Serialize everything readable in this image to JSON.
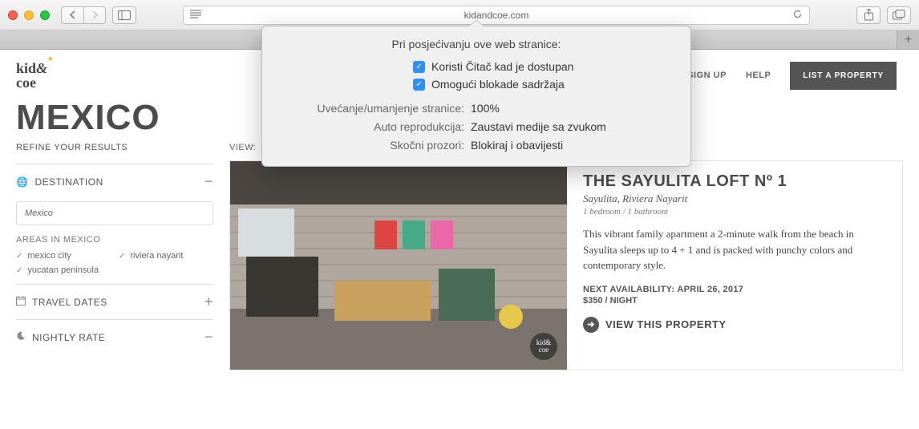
{
  "browser": {
    "url": "kidandcoe.com"
  },
  "site": {
    "logo_line1": "kid",
    "logo_amp": "&",
    "logo_line2": "coe",
    "nav": {
      "signup": "SIGN UP",
      "help": "HELP",
      "cta": "LIST A PROPERTY"
    },
    "page_title": "MEXICO",
    "refine_label": "REFINE YOUR RESULTS",
    "view_label": "VIEW:",
    "filters": {
      "destination": {
        "label": "DESTINATION",
        "input_value": "Mexico",
        "areas_label": "AREAS IN MEXICO",
        "areas": [
          "mexico city",
          "riviera nayarit",
          "yucatan peninsula"
        ]
      },
      "travel_dates": {
        "label": "TRAVEL DATES"
      },
      "nightly_rate": {
        "label": "NIGHTLY RATE"
      }
    },
    "listing": {
      "title": "THE SAYULITA LOFT Nº 1",
      "location": "Sayulita, Riviera Nayarit",
      "meta": "1 bedroom / 1 bathroom",
      "description": "This vibrant family apartment a 2-minute walk from the beach in Sayulita sleeps up to 4 + 1 and is packed with punchy colors and contemporary style.",
      "availability": "NEXT AVAILABILITY: APRIL 26, 2017",
      "price": "$350 / NIGHT",
      "view_label": "VIEW THIS PROPERTY",
      "badge": "kid& coe"
    }
  },
  "popover": {
    "title": "Pri posjećivanju ove web stranice:",
    "check1": "Koristi Čitač kad je dostupan",
    "check2": "Omogući blokade sadržaja",
    "row1_label": "Uvećanje/umanjenje stranice:",
    "row1_value": "100%",
    "row2_label": "Auto reprodukcija:",
    "row2_value": "Zaustavi medije sa zvukom",
    "row3_label": "Skočni prozori:",
    "row3_value": "Blokiraj i obavijesti"
  }
}
